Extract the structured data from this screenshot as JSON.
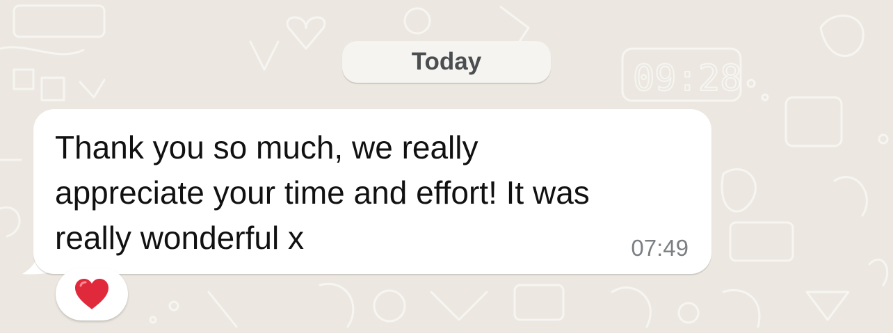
{
  "chat": {
    "date_divider": "Today",
    "message": {
      "text": "Thank you so much, we really\nappreciate your time and effort!  It was\nreally wonderful x",
      "time": "07:49",
      "reaction": {
        "emoji": "❤️",
        "icon": "red-heart-icon"
      }
    }
  },
  "colors": {
    "wallpaper": "#ECE8E1",
    "bubble": "#FFFFFF",
    "date_pill": "#F6F4F0",
    "heart": "#E02A3B"
  }
}
